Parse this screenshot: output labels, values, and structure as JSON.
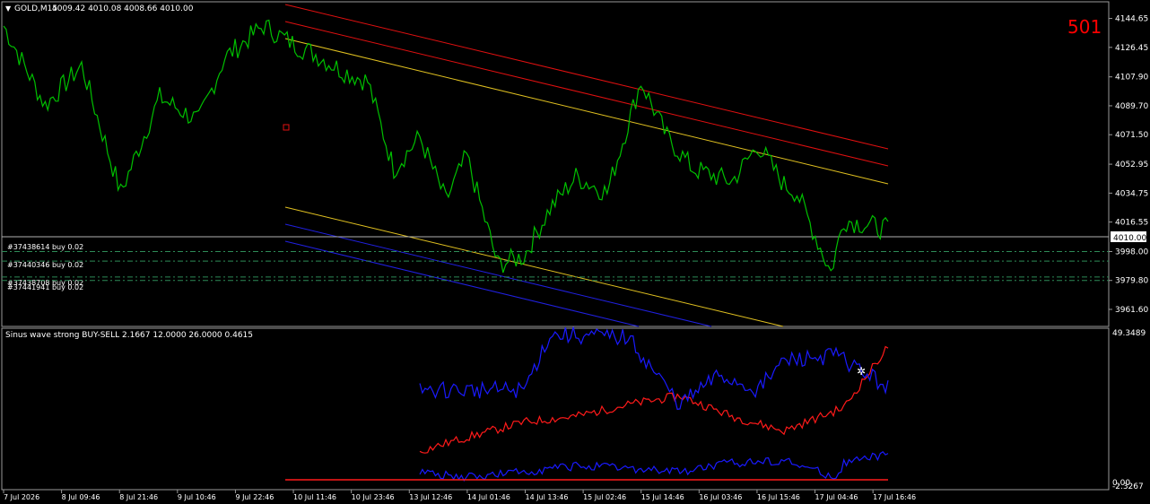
{
  "main": {
    "symbol_label": "GOLD,M15",
    "ohlc": "4009.42 4010.08 4008.66 4010.00",
    "counter": "501",
    "current_price_label": "4010.00",
    "price_axis_ticks": [
      "4144.65",
      "4126.45",
      "4107.90",
      "4089.70",
      "4071.50",
      "4052.95",
      "4034.75",
      "4016.55",
      "3998.00",
      "3979.80",
      "3961.60"
    ],
    "orders": [
      {
        "label": "#37438614 buy 0.02",
        "price": 3998.0
      },
      {
        "label": "#37440346 buy 0.02",
        "price": 3992.0
      },
      {
        "label": "#37438708 buy 0.02",
        "price": 3982.0
      },
      {
        "label": "#37441941 buy 0.02",
        "price": 3979.8
      }
    ]
  },
  "indicator": {
    "label": "Sinus wave strong BUY-SELL 2.1667 12.0000 26.0000 0.4615",
    "top_value": "49.3489",
    "zero_label": "0.00",
    "min_label": "-2.3267"
  },
  "time_axis": [
    "7 Jul 2026",
    "8 Jul 09:46",
    "8 Jul 21:46",
    "9 Jul 10:46",
    "9 Jul 22:46",
    "10 Jul 11:46",
    "10 Jul 23:46",
    "13 Jul 12:46",
    "14 Jul 01:46",
    "14 Jul 13:46",
    "15 Jul 02:46",
    "15 Jul 14:46",
    "16 Jul 03:46",
    "16 Jul 15:46",
    "17 Jul 04:46",
    "17 Jul 16:46"
  ],
  "colors": {
    "background": "#000000",
    "price_line": "#00c000",
    "channel_red": "#e01010",
    "channel_yellow": "#e0c020",
    "channel_blue": "#2020e0",
    "order_line": "#2e8b57",
    "indicator_blue": "#1a1aff",
    "indicator_red": "#ff1a1a",
    "counter": "#ff0000",
    "text": "#ffffff"
  },
  "chart_data": [
    {
      "type": "line",
      "title": "GOLD,M15",
      "ylim": [
        3952,
        4154
      ],
      "x_index": [
        0,
        16,
        30,
        45,
        60,
        75,
        85,
        100,
        112,
        120,
        130,
        140,
        150,
        160,
        170,
        178,
        190,
        200,
        210,
        220,
        232,
        245,
        255,
        265,
        280,
        290,
        300,
        305,
        318,
        323,
        340
      ],
      "values": [
        4140,
        4090,
        4115,
        4035,
        4095,
        4080,
        4120,
        4140,
        4128,
        4122,
        4112,
        4105,
        4050,
        4070,
        4030,
        4058,
        3990,
        3995,
        4025,
        4045,
        4035,
        4105,
        4070,
        4050,
        4042,
        4065,
        4040,
        4035,
        3985,
        4018,
        4012
      ]
    },
    {
      "type": "line",
      "title": "Sinus wave strong BUY-SELL 2.1667 12.0000 26.0000 0.4615",
      "ylim": [
        -2.3267,
        49.3489
      ],
      "series": [
        {
          "x_index": [
            160,
            175,
            200,
            220,
            240,
            260,
            280,
            300,
            323,
            340
          ],
          "values": [
            9,
            13,
            19,
            21,
            25,
            28,
            21,
            16,
            24,
            45
          ]
        },
        {
          "x_index": [
            160,
            175,
            190,
            200,
            220,
            240,
            260,
            280,
            300,
            320,
            323,
            340
          ],
          "values": [
            2,
            0,
            1,
            2,
            4,
            3,
            2,
            5,
            6,
            0,
            5,
            8
          ]
        },
        {
          "x_index": [
            160,
            200,
            210,
            240,
            260,
            275,
            290,
            300,
            320,
            340
          ],
          "values": [
            30,
            30,
            49,
            48,
            25,
            35,
            30,
            40,
            42,
            31
          ]
        }
      ]
    }
  ]
}
